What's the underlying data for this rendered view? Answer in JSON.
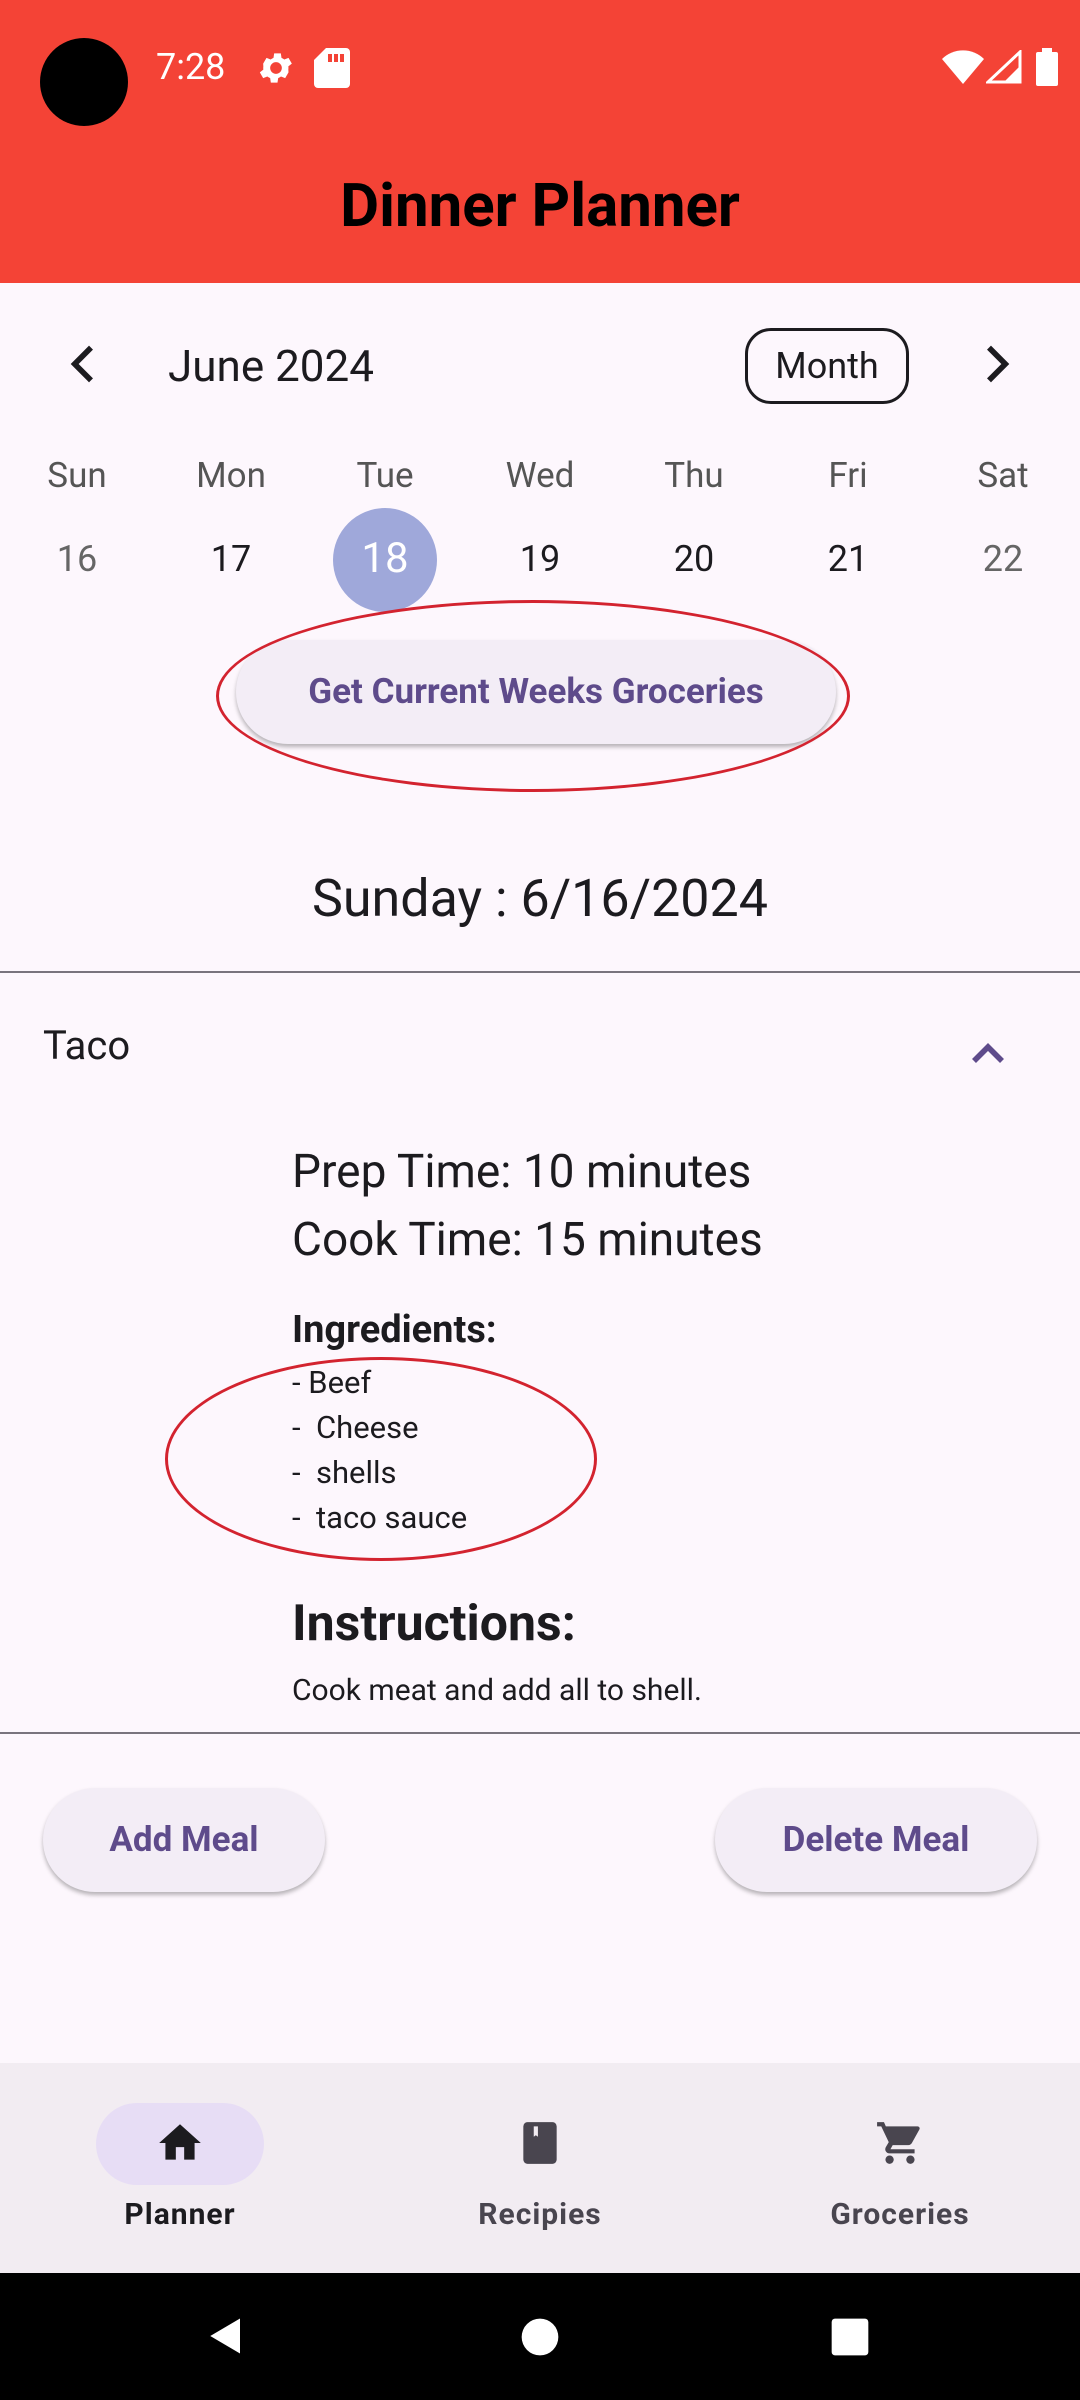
{
  "status_bar": {
    "time": "7:28"
  },
  "app_bar": {
    "title": "Dinner Planner"
  },
  "calendar": {
    "month_label": "June 2024",
    "view_button": "Month",
    "weekdays": [
      "Sun",
      "Mon",
      "Tue",
      "Wed",
      "Thu",
      "Fri",
      "Sat"
    ],
    "dates": [
      "16",
      "17",
      "18",
      "19",
      "20",
      "21",
      "22"
    ],
    "selected_date": "18"
  },
  "groceries_button": "Get Current Weeks Groceries",
  "day_heading": "Sunday : 6/16/2024",
  "meal": {
    "name": "Taco",
    "prep_time": "Prep Time: 10 minutes",
    "cook_time": "Cook Time: 15 minutes",
    "ingredients_heading": "Ingredients:",
    "ingredients": [
      "- Beef",
      "-  Cheese",
      "-  shells",
      "-  taco sauce"
    ],
    "instructions_heading": "Instructions:",
    "instructions": "Cook meat and add all to shell."
  },
  "actions": {
    "add": "Add Meal",
    "delete": "Delete Meal"
  },
  "bottom_nav": {
    "items": [
      {
        "label": "Planner",
        "icon": "home-icon",
        "active": true
      },
      {
        "label": "Recipies",
        "icon": "book-icon",
        "active": false
      },
      {
        "label": "Groceries",
        "icon": "cart-icon",
        "active": false
      }
    ]
  },
  "colors": {
    "app_bar": "#f44336",
    "accent_text": "#5e4b8b",
    "today_circle": "#9fa8da",
    "annotation": "#d3232f"
  }
}
